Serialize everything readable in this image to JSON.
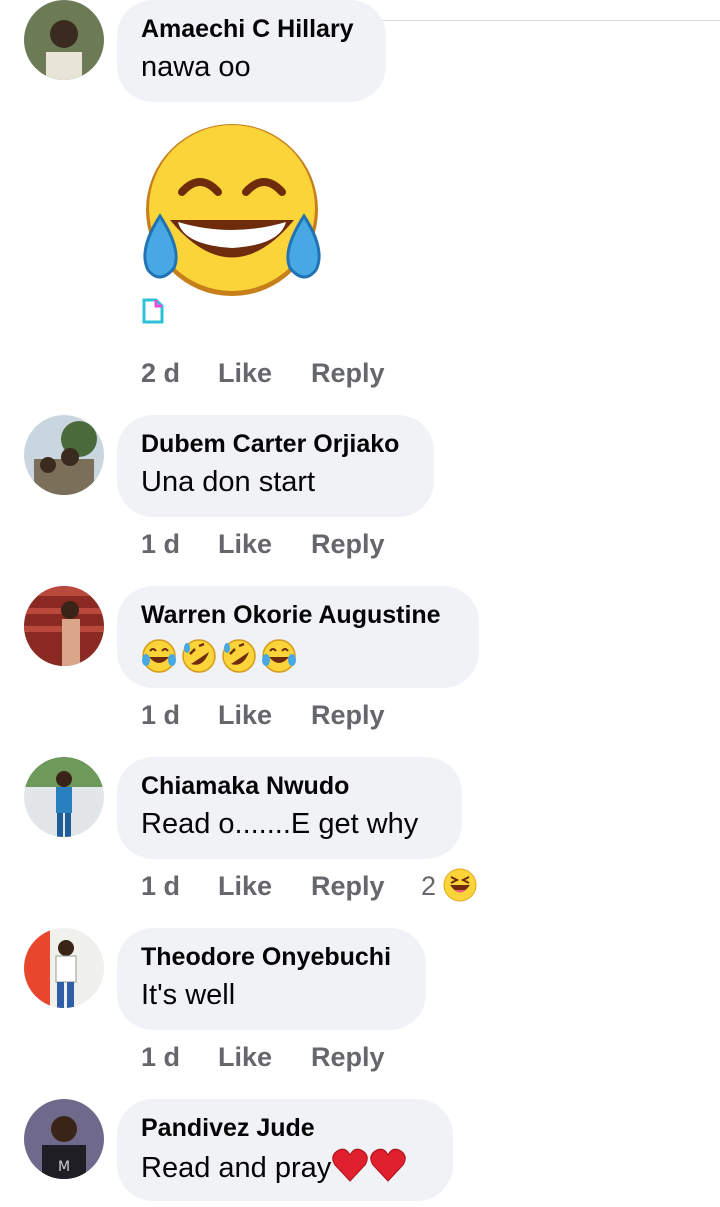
{
  "comments": [
    {
      "author": "Amaechi C Hillary",
      "text": "nawa oo",
      "time": "2 d",
      "like": "Like",
      "reply": "Reply",
      "sticker": "laughing-crying-emoji"
    },
    {
      "author": "Dubem Carter Orjiako",
      "text": "Una don start",
      "time": "1 d",
      "like": "Like",
      "reply": "Reply"
    },
    {
      "author": "Warren Okorie Augustine",
      "text": "",
      "emojis": [
        "face-with-tears-of-joy",
        "rolling-on-floor-laughing",
        "rolling-on-floor-laughing",
        "face-with-tears-of-joy"
      ],
      "time": "1 d",
      "like": "Like",
      "reply": "Reply"
    },
    {
      "author": "Chiamaka Nwudo",
      "text": "Read o.......E get why",
      "time": "1 d",
      "like": "Like",
      "reply": "Reply",
      "reaction_count": "2",
      "reaction_icon": "haha-reaction-icon"
    },
    {
      "author": "Theodore Onyebuchi",
      "text": "It's well",
      "time": "1 d",
      "like": "Like",
      "reply": "Reply"
    },
    {
      "author": "Pandivez Jude",
      "text": "Read and pray",
      "trailing_emojis": [
        "red-heart",
        "red-heart"
      ]
    }
  ],
  "colors": {
    "bubble": "#f0f2f5",
    "meta_text": "#65676b",
    "heart": "#e0202c",
    "emoji_yellow": "#fbd43a"
  }
}
